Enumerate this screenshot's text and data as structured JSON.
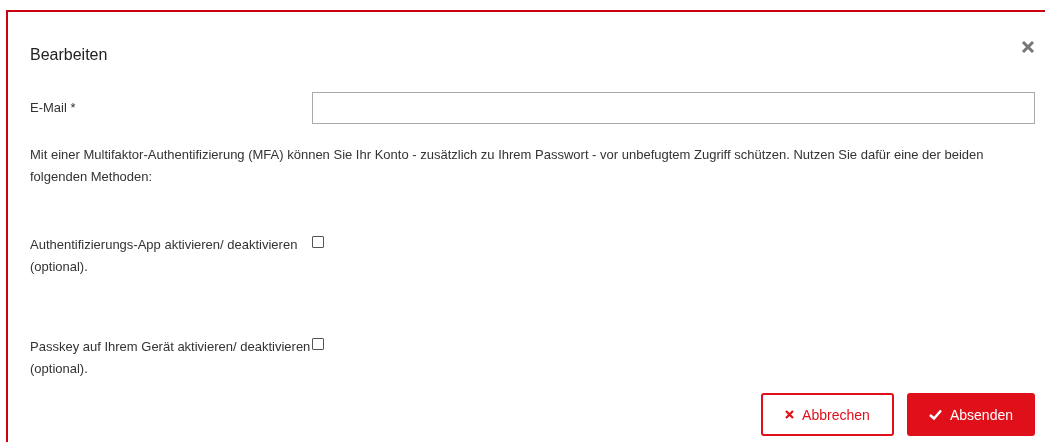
{
  "dialog": {
    "title": "Bearbeiten"
  },
  "email": {
    "label": "E-Mail *"
  },
  "description": "Mit einer Multifaktor-Authentifizierung (MFA) können Sie Ihr Konto - zusätzlich zu Ihrem Passwort - vor unbefugtem Zugriff schützen. Nutzen Sie dafür eine der beiden folgenden Methoden:",
  "options": [
    {
      "label": "Authentifizierungs-App aktivieren/ deaktivieren (optional).",
      "checked": false
    },
    {
      "label": "Passkey auf Ihrem Gerät aktivieren/ deaktivieren (optional).",
      "checked": false
    }
  ],
  "buttons": [
    {
      "kind": "cancel",
      "label": "Abbrechen"
    },
    {
      "kind": "submit",
      "label": "Absenden"
    }
  ]
}
